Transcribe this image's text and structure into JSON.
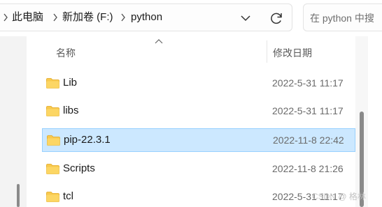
{
  "address_bar": {
    "breadcrumbs": [
      "此电脑",
      "新加卷 (F:)",
      "python"
    ],
    "dropdown_icon": "chevron-down-icon",
    "refresh_icon": "refresh-icon"
  },
  "search": {
    "placeholder": "在 python 中搜"
  },
  "columns": {
    "name": "名称",
    "date_modified": "修改日期"
  },
  "files": [
    {
      "name": "Lib",
      "date": "2022-5-31 11:17",
      "type": "folder",
      "selected": false
    },
    {
      "name": "libs",
      "date": "2022-5-31 11:17",
      "type": "folder",
      "selected": false
    },
    {
      "name": "pip-22.3.1",
      "date": "2022-11-8 22:42",
      "type": "folder",
      "selected": true
    },
    {
      "name": "Scripts",
      "date": "2022-11-8 21:26",
      "type": "folder",
      "selected": false
    },
    {
      "name": "tcl",
      "date": "2022-5-31 11:17",
      "type": "folder",
      "selected": false
    }
  ],
  "colors": {
    "selection_bg": "#cce8ff",
    "selection_border": "#99d1ff",
    "folder": "#f8c94e"
  },
  "watermark": "CSDN @ 格林"
}
